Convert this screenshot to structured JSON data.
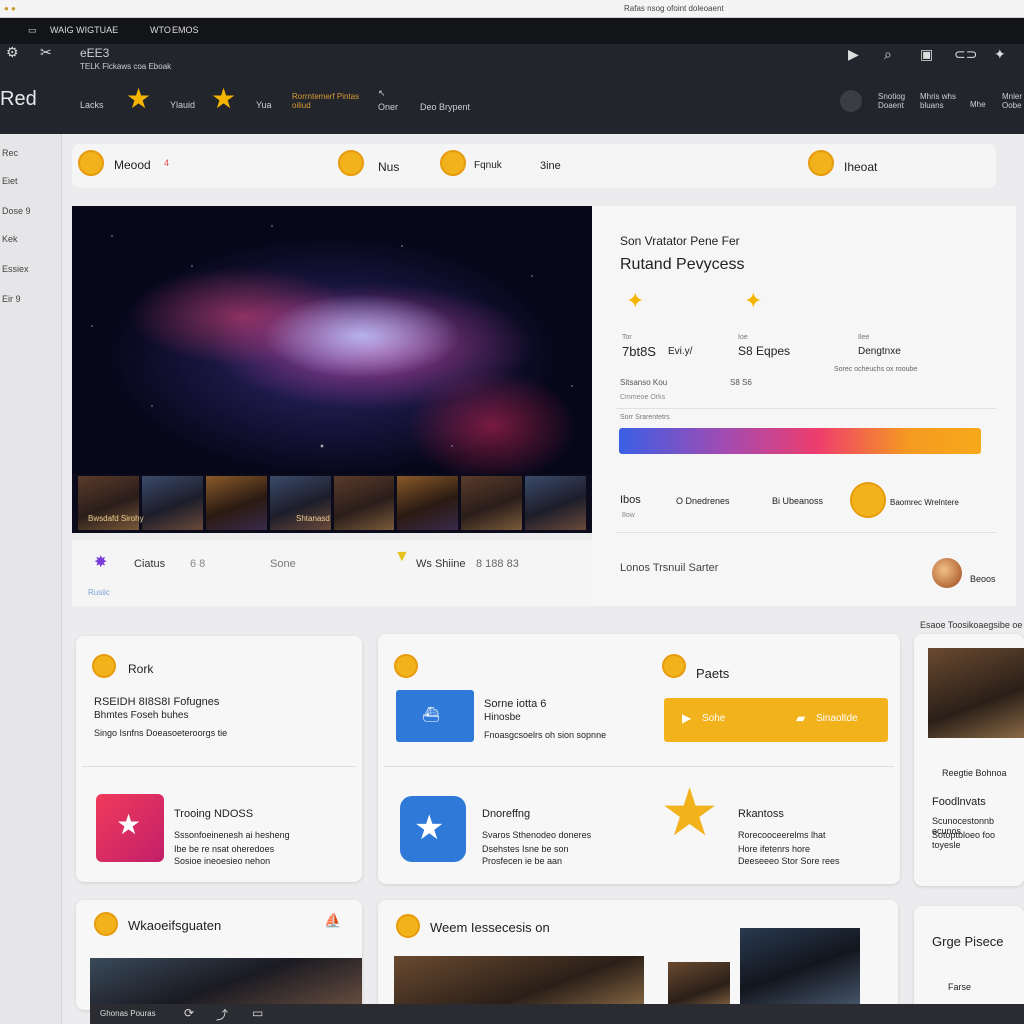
{
  "window": {
    "title": "Rafas nsog ofoint doleoaent"
  },
  "topbar": {
    "items": [
      "WAIG WIGTUAE",
      "WTO",
      "EMOS"
    ],
    "brand": "eEE3",
    "brand_sub": "TELK Flckaws coa Eboak"
  },
  "nav": {
    "logo": "Red",
    "items": [
      "Lacks",
      "Ylauid",
      "Yua",
      "Rorrntemerf Pintas oiliud",
      "Oner",
      "Deo Brypent"
    ],
    "right": [
      "Snotiog Doaent",
      "Mhris whs bluans",
      "Mhe",
      "Mnler Oobe"
    ]
  },
  "sidebar": {
    "items": [
      "Rec",
      "Eiet",
      "Dose 9",
      "Kek",
      "Essiex",
      "Eir 9"
    ]
  },
  "tabs": [
    {
      "label": "Meood",
      "badge": "4"
    },
    {
      "label": "Nus"
    },
    {
      "label": "Fqnuk"
    },
    {
      "label": "3ine"
    },
    {
      "label": "Iheoat"
    }
  ],
  "hero": {
    "caption_left": "Bwsdafd Sirohy",
    "caption_right": "Shtanasd"
  },
  "info": {
    "eyebrow": "Son Vratator Pene Fer",
    "title": "Rutand Pevycess",
    "stats": [
      {
        "top": "Tor",
        "value": "7bt8S",
        "unit": "Evi.y/",
        "label": "Sitsanso Kou",
        "note": "Cmmeoe Orks"
      },
      {
        "top": "Ioe",
        "value": "S8 Eqpes",
        "label": "S8 S6"
      },
      {
        "top": "Ilee",
        "value": "Dengtnxe",
        "label": "Sorec ocheuchs ox rooube"
      }
    ],
    "bar_label": "Sorr Srarentetrs",
    "progress": 1.0,
    "meta": [
      "Ibos",
      "O Dnedrenes",
      "Bi Ubeanoss",
      "Baomrec Wrelntere"
    ],
    "meta_sub": "8ow",
    "footer": "Lonos Trsnuil Sarter",
    "footer_right": "Beoos"
  },
  "below_hero": {
    "left": "Ciatus",
    "left_nums": "6  8",
    "mid": "Sone",
    "right": "Ws Shiine",
    "right_nums": "8   188 83",
    "link": "Rusiic"
  },
  "cards": {
    "c1": {
      "title": "Rork",
      "heading": "RSEIDH 8I8S8I Fofugnes",
      "heading2": "Bhmtes Foseh buhes",
      "sub": "Singo Isnfns Doeasoeteroorgs tie",
      "item_title": "Trooing NDOSS",
      "item_lines": [
        "Sssonfoeinenesh ai hesheng",
        "Ibe be re nsat oheredoes",
        "Sosioe ineoesieo nehon"
      ]
    },
    "c2": {
      "title_a": "Sorne iotta 6",
      "title_b": "Hinosbe",
      "sub": "Fnoasgcsoelrs oh sion sopnne",
      "item_title": "Dnoreffng",
      "item_lines": [
        "Svaros Sthenodeo doneres",
        "Dsehstes Isne be son",
        "Prosfecen ie be aan"
      ]
    },
    "c3": {
      "title": "Paets",
      "btn_left": "Sohe",
      "btn_right": "Sinaoltde",
      "item_title": "Rkantoss",
      "item_lines": [
        "Rorecooceerelms lhat",
        "Hore ifetenrs hore",
        "Deeseeeo Stor Sore rees"
      ]
    },
    "c4": {
      "header": "Esaoe Toosikoaegsibe oe",
      "title": "Reegtie Bohnoa",
      "sub_title": "Foodlnvats",
      "sub": "Scunocestonnb ecunos",
      "sub2": "Sotoptbloeo foo toyesle"
    },
    "c5": {
      "title": "Wkaoeifsguaten"
    },
    "c6": {
      "title": "Weem Iessecesis on"
    },
    "c7": {
      "title": "Grge Pisece",
      "sub": "Farse"
    }
  },
  "bottombar": {
    "label": "Ghonas Pouras"
  },
  "colors": {
    "accent": "#f2b21b",
    "brand_blue": "#2f7ad9",
    "pink": "#e2365e",
    "dark": "#22252c"
  }
}
